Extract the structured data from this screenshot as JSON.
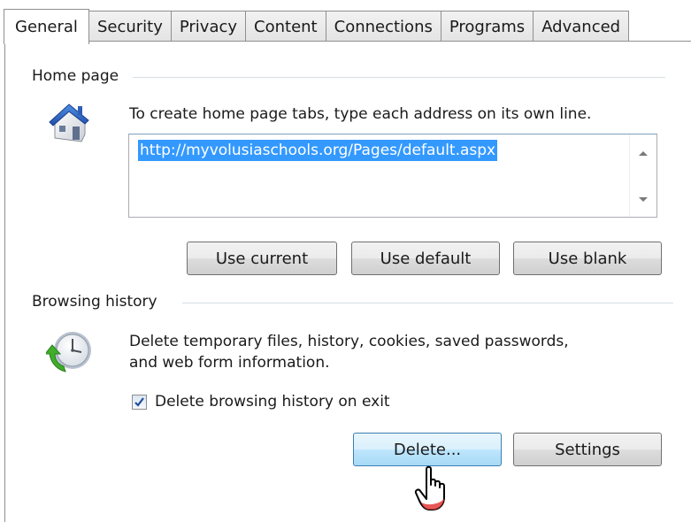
{
  "tabs": [
    {
      "label": "General",
      "active": true
    },
    {
      "label": "Security",
      "active": false
    },
    {
      "label": "Privacy",
      "active": false
    },
    {
      "label": "Content",
      "active": false
    },
    {
      "label": "Connections",
      "active": false
    },
    {
      "label": "Programs",
      "active": false
    },
    {
      "label": "Advanced",
      "active": false
    }
  ],
  "home_page": {
    "group_title": "Home page",
    "icon": "house-icon",
    "description": "To create home page tabs, type each address on its own line.",
    "url": "http://myvolusiaschools.org/Pages/default.aspx",
    "buttons": {
      "use_current": "Use current",
      "use_default": "Use default",
      "use_blank": "Use blank"
    }
  },
  "browsing_history": {
    "group_title": "Browsing history",
    "icon": "history-clock-icon",
    "description_line1": "Delete temporary files, history, cookies, saved passwords,",
    "description_line2": "and web form information.",
    "checkbox_label": "Delete browsing history on exit",
    "checkbox_checked": true,
    "buttons": {
      "delete": "Delete...",
      "settings": "Settings"
    }
  },
  "colors": {
    "selection": "#3399ff",
    "accent_border": "#3c7fb1",
    "group_line": "#d5dfe5"
  }
}
